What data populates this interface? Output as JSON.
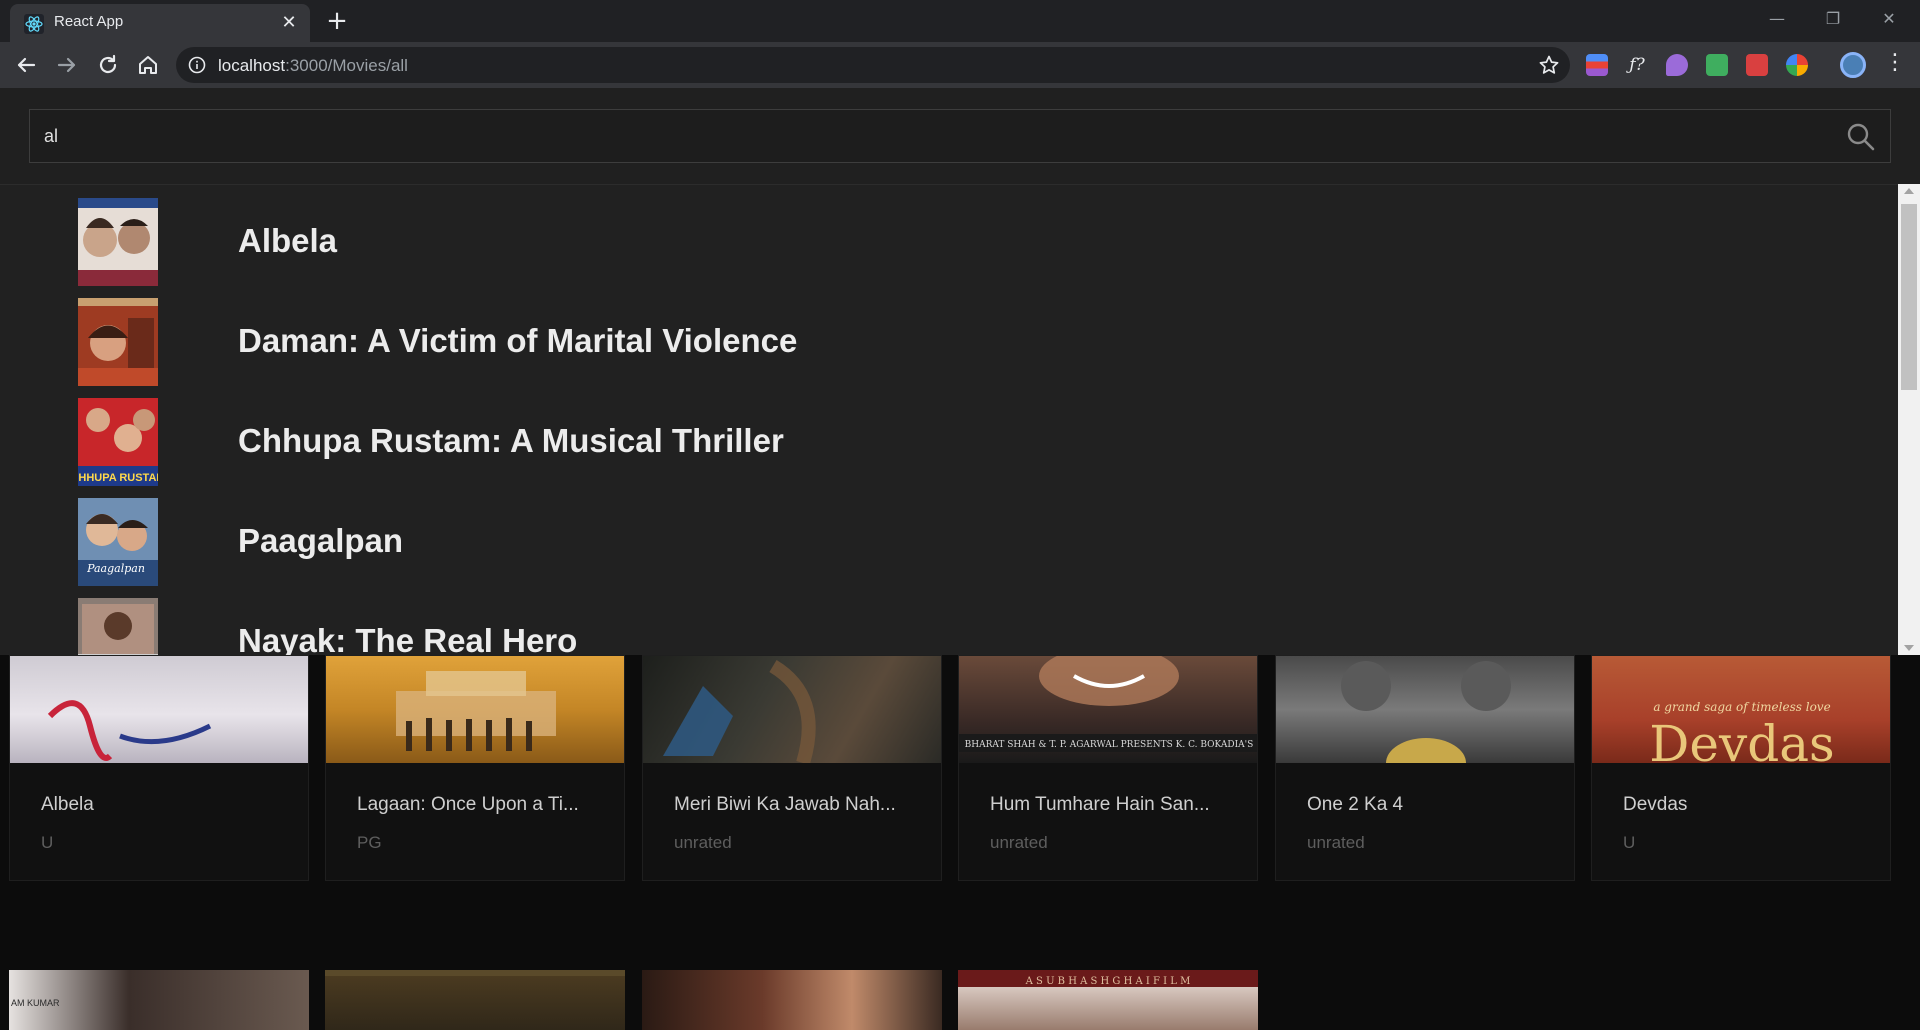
{
  "browser": {
    "tab_title": "React App",
    "url_host": "localhost",
    "url_rest": ":3000/Movies/all",
    "icons": [
      "react-favicon",
      "close-icon",
      "plus-icon",
      "back-arrow-icon",
      "forward-arrow-icon",
      "reload-icon",
      "home-icon",
      "info-icon",
      "star-icon",
      "minimize-icon",
      "restore-icon",
      "close-window-icon",
      "kebab-menu-icon"
    ]
  },
  "search": {
    "value": "al",
    "icon": "search-icon"
  },
  "dropdown": {
    "results": [
      {
        "title": "Albela",
        "color": "#c9a48a"
      },
      {
        "title": "Daman: A Victim of Marital Violence",
        "color": "#9e3b22"
      },
      {
        "title": "Chhupa Rustam: A Musical Thriller",
        "color": "#c8262a"
      },
      {
        "title": "Paagalpan",
        "color": "#6f8fb3"
      },
      {
        "title": "Nayak: The Real Hero",
        "color": "#8a7c74"
      }
    ]
  },
  "grid": {
    "cards": [
      {
        "title": "Albela",
        "rating": "U",
        "color": "#c7c3c9"
      },
      {
        "title": "Lagaan: Once Upon a Ti...",
        "rating": "PG",
        "color": "#c08a2a"
      },
      {
        "title": "Meri Biwi Ka Jawab Nah...",
        "rating": "unrated",
        "color": "#2a2a26"
      },
      {
        "title": "Hum Tumhare Hain San...",
        "rating": "unrated",
        "color": "#3a2a26"
      },
      {
        "title": "One 2 Ka 4",
        "rating": "unrated",
        "color": "#6a6a6a"
      },
      {
        "title": "Devdas",
        "rating": "U",
        "color": "#a8402a"
      }
    ],
    "row2": [
      {
        "color": "#2f2a28"
      },
      {
        "color": "#2b2418"
      },
      {
        "color": "#3a2a22"
      },
      {
        "color": "#5a1a1a"
      }
    ],
    "row2_print": {
      "card4": "A  S U B H A S H  G H A I  F I L M",
      "card1": "AM KUMAR"
    },
    "poster_prints": {
      "devdas": "a grand saga of timeless love",
      "devdas_title": "Devdas",
      "hum": "BHARAT SHAH & T. P. AGARWAL PRESENTS   K. C. BOKADIA'S"
    }
  }
}
